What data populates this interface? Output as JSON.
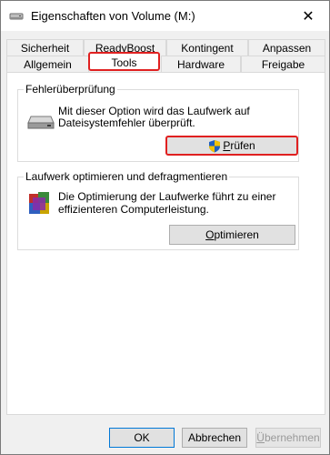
{
  "window": {
    "title": "Eigenschaften von Volume (M:)",
    "close_glyph": "✕"
  },
  "tabs": {
    "row1": [
      "Sicherheit",
      "ReadyBoost",
      "Kontingent",
      "Anpassen"
    ],
    "row2": [
      "Allgemein",
      "Tools",
      "Hardware",
      "Freigabe"
    ],
    "active": "Tools"
  },
  "error_check": {
    "title": "Fehlerüberprüfung",
    "description_line1": "Mit dieser Option wird das Laufwerk auf",
    "description_line2": "Dateisystemfehler überprüft.",
    "button_accesskey": "P",
    "button_rest": "rüfen"
  },
  "optimize": {
    "title": "Laufwerk optimieren und defragmentieren",
    "description_line1": "Die Optimierung der Laufwerke führt zu einer",
    "description_line2": "effizienteren Computerleistung.",
    "button_accesskey": "O",
    "button_rest": "ptimieren"
  },
  "footer": {
    "ok_label": "OK",
    "cancel_label": "Abbrechen",
    "apply_accesskey": "Ü",
    "apply_rest": "bernehmen"
  },
  "colors": {
    "highlight": "#e02020",
    "shield_blue": "#1f5fbf",
    "shield_yellow": "#f2c200"
  }
}
